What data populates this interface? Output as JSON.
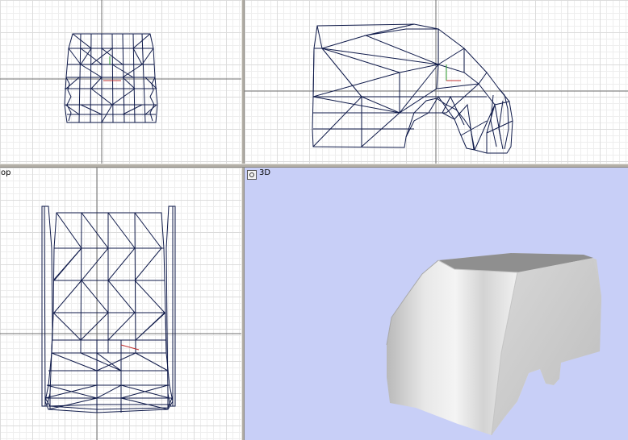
{
  "viewports": {
    "front": {
      "label": ""
    },
    "side": {
      "label": ""
    },
    "top": {
      "label": "op"
    },
    "perspective": {
      "label": "3D"
    }
  },
  "colors": {
    "grid_background": "#ffffff",
    "perspective_background": "#c8cff7",
    "wireframe": "#0f1a4a",
    "axis_line": "#6f6f6f"
  },
  "icons": {
    "viewport_menu": "viewport-menu-icon"
  }
}
